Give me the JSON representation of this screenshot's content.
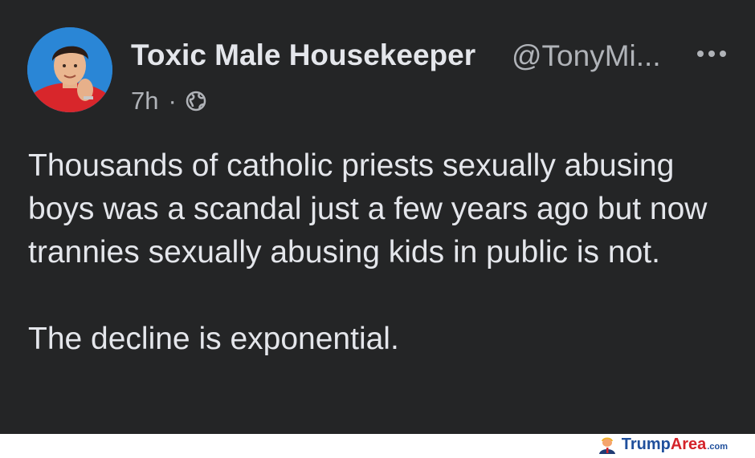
{
  "post": {
    "author_name": "Toxic Male Housekeeper",
    "author_handle": "@TonyMi...",
    "time": "7h",
    "separator": "·",
    "privacy_icon": "globe-icon",
    "more_icon": "more-options-icon",
    "body_paragraph_1": "Thousands of catholic priests sexually abusing boys was a scandal just a few years ago but now trannies sexually abusing kids in public is not.",
    "body_paragraph_2": "The decline is exponential."
  },
  "watermark": {
    "brand_part_1": "Trump",
    "brand_part_2": "Area",
    "brand_suffix": ".com",
    "colors": {
      "blue": "#1f4f9c",
      "red": "#d4232a"
    }
  },
  "colors": {
    "background": "#242526",
    "primary_text": "#e4e6eb",
    "secondary_text": "#b0b3b8"
  }
}
